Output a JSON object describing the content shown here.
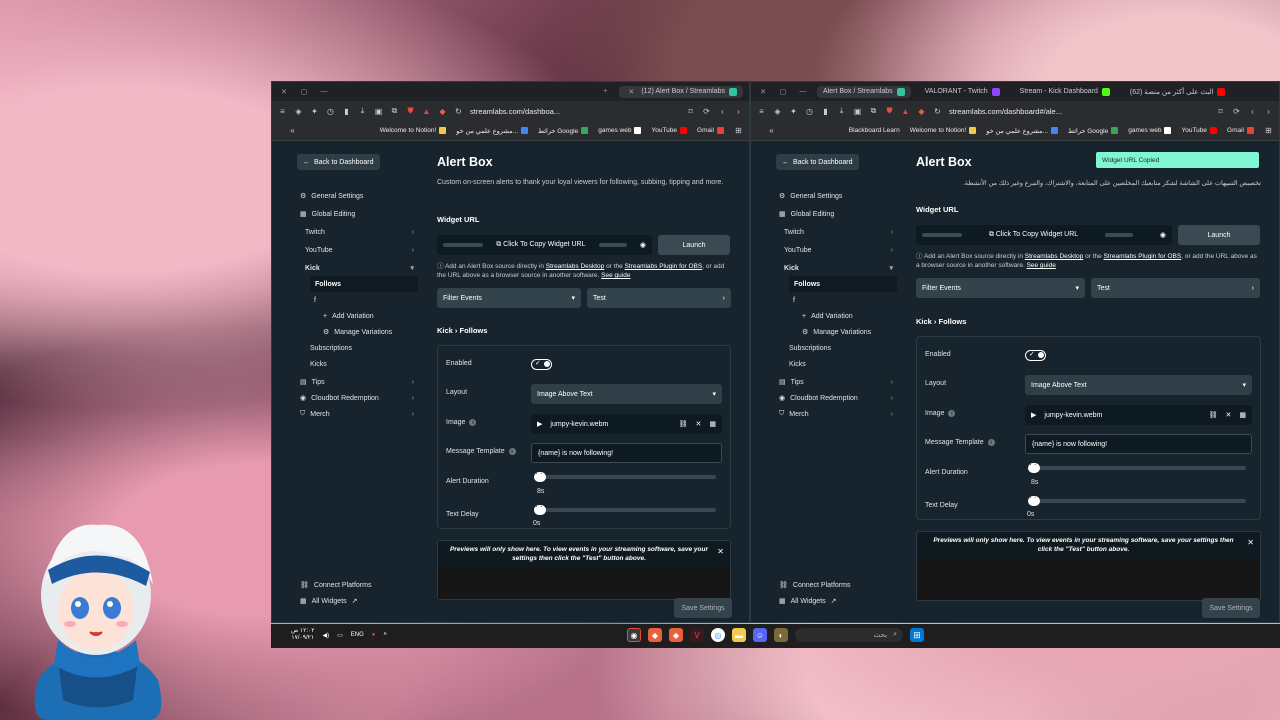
{
  "left": {
    "tabs": [
      "(12) Alert Box / Streamlabs"
    ],
    "url": "streamlabs.com/dashboa...",
    "bookmarks": [
      "Welcome to Notion!",
      "مشروع علمي من خو...",
      "خرائط Google",
      "games web",
      "YouTube",
      "Gmail"
    ],
    "back": "Back to Dashboard",
    "nav": {
      "general": "General Settings",
      "global": "Global Editing",
      "twitch": "Twitch",
      "youtube": "YouTube",
      "kick": "Kick",
      "follows": "Follows",
      "f": "f",
      "add_variation": "Add Variation",
      "manage_variations": "Manage Variations",
      "subscriptions": "Subscriptions",
      "kicks": "Kicks",
      "tips": "Tips",
      "cloudbot": "Cloudbot Redemption",
      "merch": "Merch",
      "connect": "Connect Platforms",
      "all_widgets": "All Widgets"
    },
    "title": "Alert Box",
    "description": "Custom on-screen alerts to thank your loyal viewers for following, subbing, tipping and more.",
    "widget_url_label": "Widget URL",
    "copy_url": "Click To Copy Widget URL",
    "launch": "Launch",
    "note_a": "Add an Alert Box source directly in ",
    "note_link1": "Streamlabs Desktop",
    "note_b": " or the ",
    "note_link2": "Streamlabs Plugin for OBS",
    "note_c": ", or add the URL above as a browser source in another software. ",
    "note_link3": "See guide",
    "filter": "Filter Events",
    "test": "Test",
    "breadcrumb": "Kick › Follows",
    "enabled": "Enabled",
    "layout": "Layout",
    "layout_value": "Image Above Text",
    "image": "Image",
    "image_value": "jumpy-kevin.webm",
    "message_template": "Message Template",
    "message_value": "{name} is now following!",
    "alert_duration": "Alert Duration",
    "alert_duration_value": "8s",
    "text_delay": "Text Delay",
    "text_delay_value": "0s",
    "preview_text": "Previews will only show here. To view events in your streaming software, save your settings then click the \"Test\" button above.",
    "save": "Save Settings"
  },
  "right": {
    "tabs": [
      "Alert Box / Streamlabs",
      "VALORANT - Twitch",
      "Stream - Kick Dashboard",
      "(62) البث على أكثر من منصة"
    ],
    "url": "streamlabs.com/dashboard#/ale...",
    "bookmarks": [
      "Blackboard Learn",
      "Welcome to Notion!",
      "مشروع علمي من خو...",
      "خرائط Google",
      "games web",
      "YouTube",
      "Gmail"
    ],
    "toast": "Widget URL Copied",
    "rtl_description": "تخصيص التنبيهات على الشاشة لشكر متابعيك المخلصين على المتابعة، والاشتراك، والتبرع وغير ذلك من الأنشطة."
  },
  "taskbar": {
    "lang": "ENG",
    "time": "١٢:٠٢ ص",
    "date": "١٧/٠٩/٢١",
    "search": "بحث"
  },
  "colors": {
    "panel_bg": "#17242d",
    "toast": "#80f5d2",
    "input_bg": "#0e1a21"
  }
}
